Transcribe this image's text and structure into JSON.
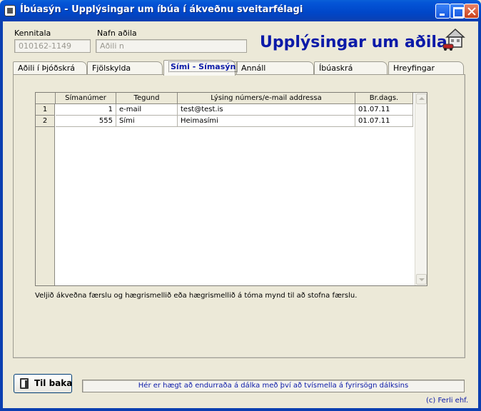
{
  "window": {
    "title": "Íbúasýn - Upplýsingar um íbúa í ákveðnu sveitarfélagi"
  },
  "header": {
    "kennitala_label": "Kennitala",
    "kennitala_value": "010162-1149",
    "nafn_label": "Nafn aðila",
    "nafn_value": "Aðili n",
    "title": "Upplýsingar um aðila",
    "icon": "house-car-icon"
  },
  "tabs": [
    {
      "label": "Aðili í Þjóðskrá"
    },
    {
      "label": "Fjölskylda"
    },
    {
      "label": "Sími - Símasýn"
    },
    {
      "label": "Annáll"
    },
    {
      "label": "Íbúaskrá"
    },
    {
      "label": "Hreyfingar"
    }
  ],
  "table": {
    "columns": [
      "Símanúmer",
      "Tegund",
      "Lýsing númers/e-mail addressa",
      "Br.dags."
    ],
    "rows": [
      {
        "num": "1",
        "cells": [
          "1",
          "e-mail",
          "test@test.is",
          "01.07.11"
        ]
      },
      {
        "num": "2",
        "cells": [
          "555",
          "Sími",
          "Heimasími",
          "01.07.11"
        ]
      }
    ]
  },
  "hint": "Veljið ákveðna færslu og hægrismellið eða hægrismellið á tóma mynd til að stofna færslu.",
  "footer": {
    "back_label": "Til baka",
    "status": "Hér er hægt að endurraða á dálka með því að tvísmella á fyrirsögn dálksins",
    "copyright": "(c) Ferli ehf."
  }
}
